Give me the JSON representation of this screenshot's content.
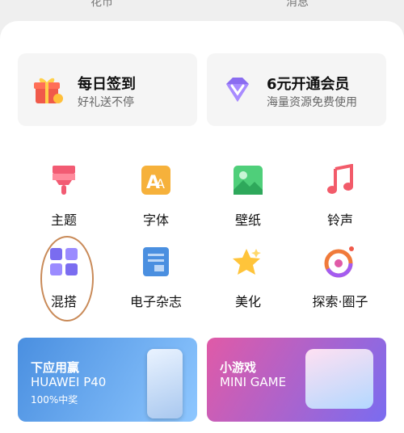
{
  "top_strip": {
    "left_text": "花币",
    "right_text": "消息"
  },
  "cards": [
    {
      "title": "每日签到",
      "subtitle": "好礼送不停",
      "icon": "gift-icon"
    },
    {
      "title": "6元开通会员",
      "subtitle": "海量资源免费使用",
      "icon": "diamond-icon"
    }
  ],
  "grid": [
    {
      "label": "主题",
      "icon": "brush-icon"
    },
    {
      "label": "字体",
      "icon": "font-icon"
    },
    {
      "label": "壁纸",
      "icon": "wallpaper-icon"
    },
    {
      "label": "铃声",
      "icon": "music-note-icon"
    },
    {
      "label": "混搭",
      "icon": "grid-icon"
    },
    {
      "label": "电子杂志",
      "icon": "magazine-icon"
    },
    {
      "label": "美化",
      "icon": "star-icon"
    },
    {
      "label": "探索·圈子",
      "icon": "explore-circle-icon"
    }
  ],
  "banners": [
    {
      "line1": "下应用赢",
      "line2": "HUAWEI P40",
      "line3": "100%中奖"
    },
    {
      "line1": "小游戏",
      "line2": "MINI GAME"
    }
  ],
  "colors": {
    "sheet_bg": "#ffffff",
    "card_bg": "#f5f5f5",
    "banner_blue": "#4a8fe0",
    "banner_pink": "#e05aa7",
    "annotation_circle": "#c98a58"
  }
}
